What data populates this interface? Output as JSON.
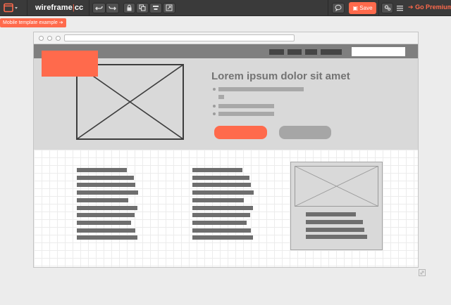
{
  "toolbar": {
    "app_name_part1": "wireframe",
    "app_name_sep": "|",
    "app_name_part2": "cc",
    "save_label": "Save",
    "premium_label": "Go Premium",
    "premium_arrow": "➔",
    "icons": {
      "menu": "window-menu-icon",
      "undo": "undo-icon",
      "redo": "redo-icon",
      "lock": "lock-icon",
      "duplicate": "duplicate-icon",
      "align": "align-icon",
      "export": "export-icon",
      "comment": "comment-icon",
      "settings": "settings-icon",
      "more": "hamburger-icon"
    },
    "colors": {
      "accent": "#ff6a4c",
      "bar": "#3a3a3a"
    }
  },
  "tag": {
    "label": "Mobile template example",
    "arrow": "➔"
  },
  "wireframe": {
    "hero_title": "Lorem ipsum dolor sit amet",
    "colors": {
      "hero_bg": "#d9d9d9",
      "nav_bg": "#7f7f7f",
      "text_block": "#6e6e6e"
    }
  }
}
